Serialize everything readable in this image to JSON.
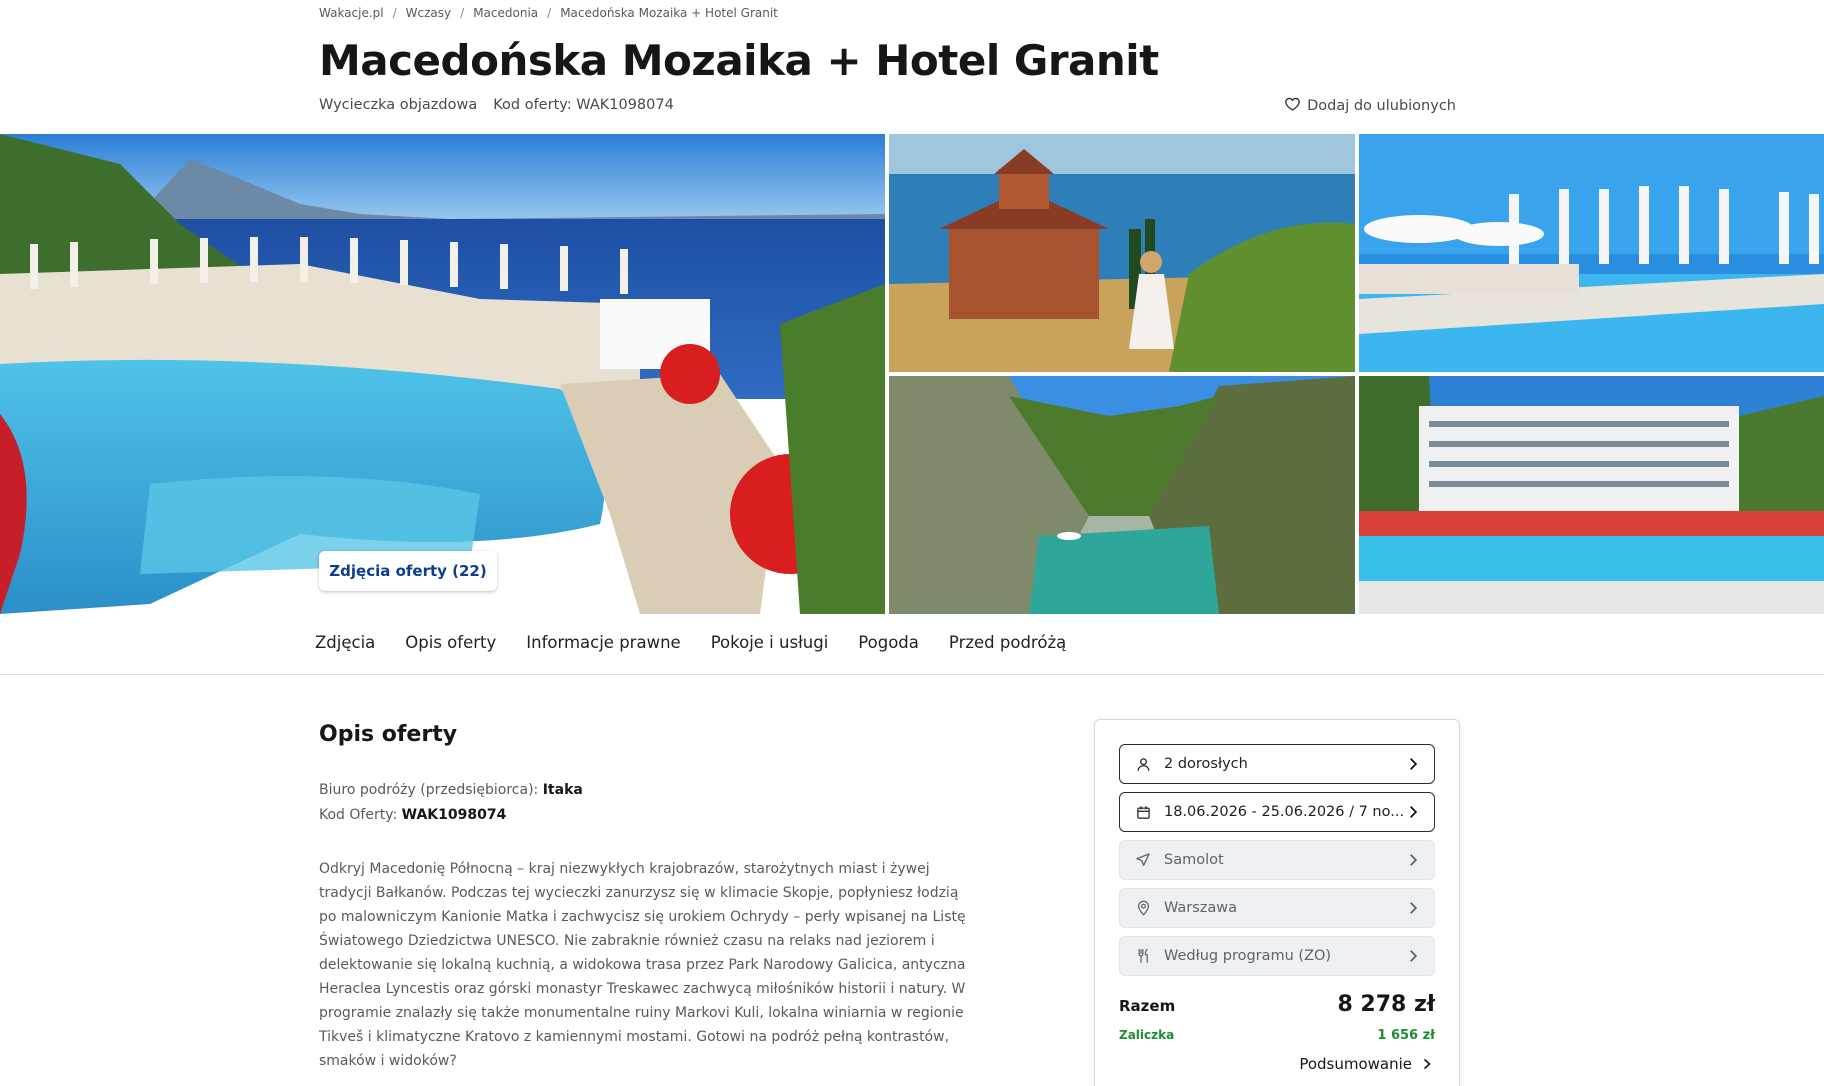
{
  "breadcrumb": [
    "Wakacje.pl",
    "Wczasy",
    "Macedonia",
    "Macedońska Mozaika + Hotel Granit"
  ],
  "title": "Macedońska Mozaika + Hotel Granit",
  "subline": {
    "trip_type": "Wycieczka objazdowa",
    "offer_code": "Kod oferty: WAK1098074"
  },
  "favorite_label": "Dodaj do ulubionych",
  "photos_button": "Zdjęcia oferty (22)",
  "tabs": [
    "Zdjęcia",
    "Opis oferty",
    "Informacje prawne",
    "Pokoje i usługi",
    "Pogoda",
    "Przed podróżą"
  ],
  "section": {
    "title": "Opis oferty",
    "operator_label": "Biuro podróży (przedsiębiorca):",
    "operator_value": "Itaka",
    "code_label": "Kod Oferty:",
    "code_value": "WAK1098074",
    "description": "Odkryj Macedonię Północną – kraj niezwykłych krajobrazów, starożytnych miast i żywej tradycji Bałkanów. Podczas tej wycieczki zanurzysz się w klimacie Skopje, popłyniesz łodzią po malowniczym Kanionie Matka i zachwycisz się urokiem Ochrydy – perły wpisanej na Listę Światowego Dziedzictwa UNESCO. Nie zabraknie również czasu na relaks nad jeziorem i delektowanie się lokalną kuchnią, a widokowa trasa przez Park Narodowy Galicica, antyczna Heraclea Lyncestis oraz górski monastyr Treskawec zachwycą miłośników historii i natury. W programie znalazły się także monumentalne ruiny Markovi Kuli, lokalna winiarnia w regionie Tikveš i klimatyczne Kratovo z kamiennymi mostami. Gotowi na podróż pełną kontrastów, smaków i widoków?"
  },
  "booking": {
    "travelers": "2 dorosłych",
    "dates": "18.06.2026 - 25.06.2026 / 7 no...",
    "transport": "Samolot",
    "departure": "Warszawa",
    "board": "Według programu (ZO)",
    "total_label": "Razem",
    "total_value": "8 278 zł",
    "deposit_label": "Zaliczka",
    "deposit_value": "1 656 zł",
    "summary_label": "Podsumowanie"
  },
  "colors": {
    "deposit_green": "#1a8f2e",
    "link_blue": "#0b3d91"
  },
  "icons": {
    "favorite": "heart-icon",
    "travelers": "user-icon",
    "dates": "calendar-icon",
    "transport": "plane-icon",
    "departure": "location-pin-icon",
    "board": "cutlery-icon",
    "chevron": "chevron-right-icon"
  }
}
